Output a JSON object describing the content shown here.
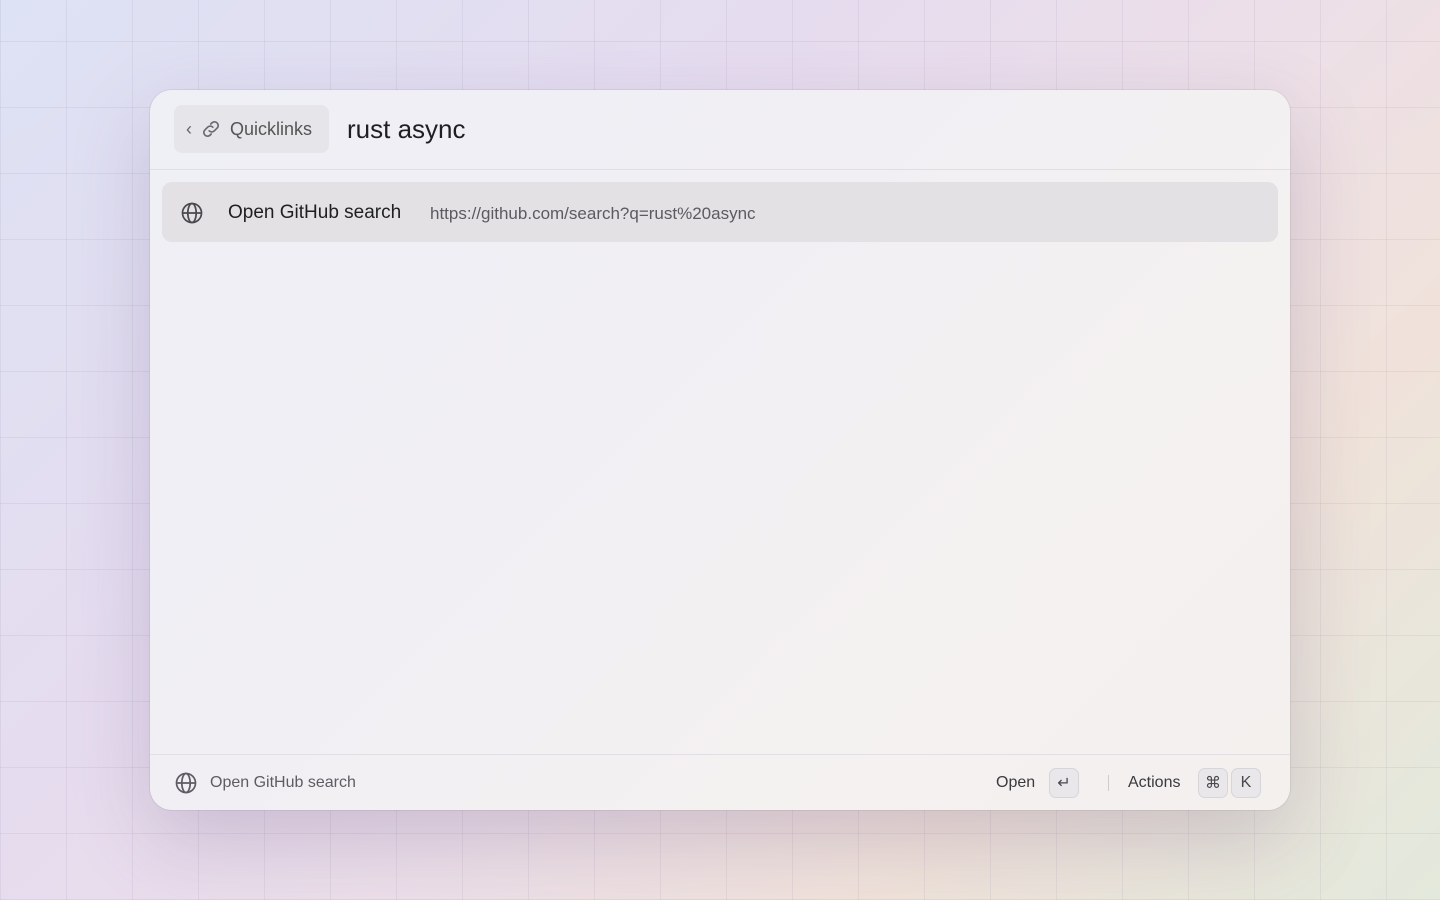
{
  "header": {
    "back_pill": {
      "chevron": "‹",
      "icon": "link-icon",
      "label": "Quicklinks"
    },
    "query": "rust async"
  },
  "results": [
    {
      "icon": "globe-icon",
      "title": "Open GitHub search",
      "subtitle": "https://github.com/search?q=rust%20async",
      "selected": true
    }
  ],
  "footer": {
    "icon": "globe-icon",
    "status": "Open GitHub search",
    "primary_action": {
      "label": "Open",
      "key": "↵"
    },
    "actions": {
      "label": "Actions",
      "keys": [
        "⌘",
        "K"
      ]
    }
  },
  "colors": {
    "selected_row": "#e3e1e4",
    "text_primary": "#1f1f22",
    "text_secondary": "#5c5a60"
  }
}
